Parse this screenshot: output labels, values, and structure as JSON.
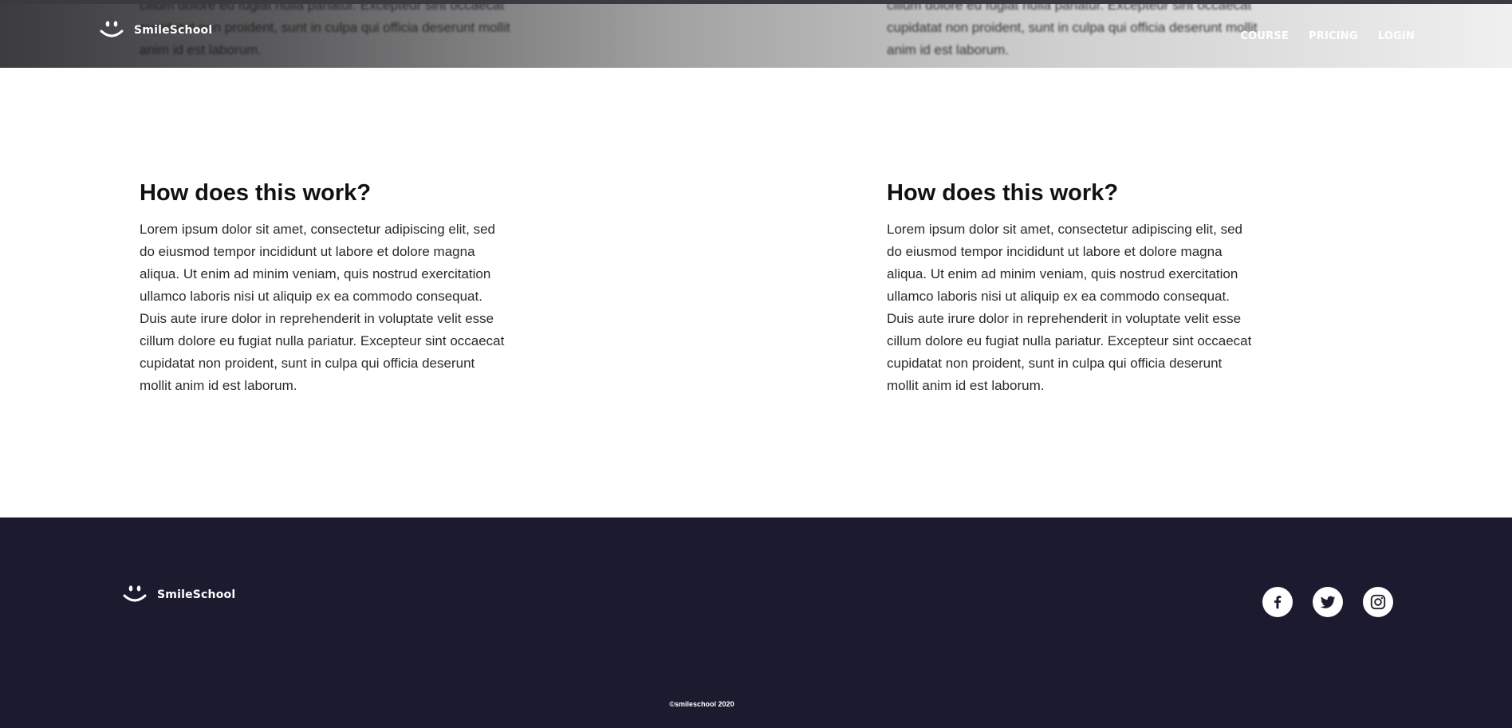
{
  "brand": {
    "name": "SmileSchool",
    "logo_icon": "smile-logo-icon"
  },
  "nav": {
    "items": [
      "COURSE",
      "PRICING",
      "LOGIN"
    ]
  },
  "header_bleed": {
    "left": "cillum dolore eu fugiat nulla pariatur. Excepteur sint occaecat cupidatat non proident, sunt in culpa qui officia deserunt mollit anim id est laborum.",
    "right": "cillum dolore eu fugiat nulla pariatur. Excepteur sint occaecat cupidatat non proident, sunt in culpa qui officia deserunt mollit anim id est laborum."
  },
  "sections": [
    {
      "title": "How does this work?",
      "body": "Lorem ipsum dolor sit amet, consectetur adipiscing elit, sed do eiusmod tempor incididunt ut labore et dolore magna aliqua. Ut enim ad minim veniam, quis nostrud exercitation ullamco laboris nisi ut aliquip ex ea commodo consequat. Duis aute irure dolor in reprehenderit in voluptate velit esse cillum dolore eu fugiat nulla pariatur. Excepteur sint occaecat cupidatat non proident, sunt in culpa qui officia deserunt mollit anim id est laborum."
    },
    {
      "title": "How does this work?",
      "body": "Lorem ipsum dolor sit amet, consectetur adipiscing elit, sed do eiusmod tempor incididunt ut labore et dolore magna aliqua. Ut enim ad minim veniam, quis nostrud exercitation ullamco laboris nisi ut aliquip ex ea commodo consequat. Duis aute irure dolor in reprehenderit in voluptate velit esse cillum dolore eu fugiat nulla pariatur. Excepteur sint occaecat cupidatat non proident, sunt in culpa qui officia deserunt mollit anim id est laborum."
    }
  ],
  "footer": {
    "brand_name": "SmileSchool",
    "social": [
      "facebook-icon",
      "twitter-icon",
      "instagram-icon"
    ],
    "copyright": "©smileschool 2020"
  },
  "colors": {
    "footer_bg": "#1c1a2e",
    "text_dark": "#111111",
    "nav_text": "#ffffff"
  }
}
